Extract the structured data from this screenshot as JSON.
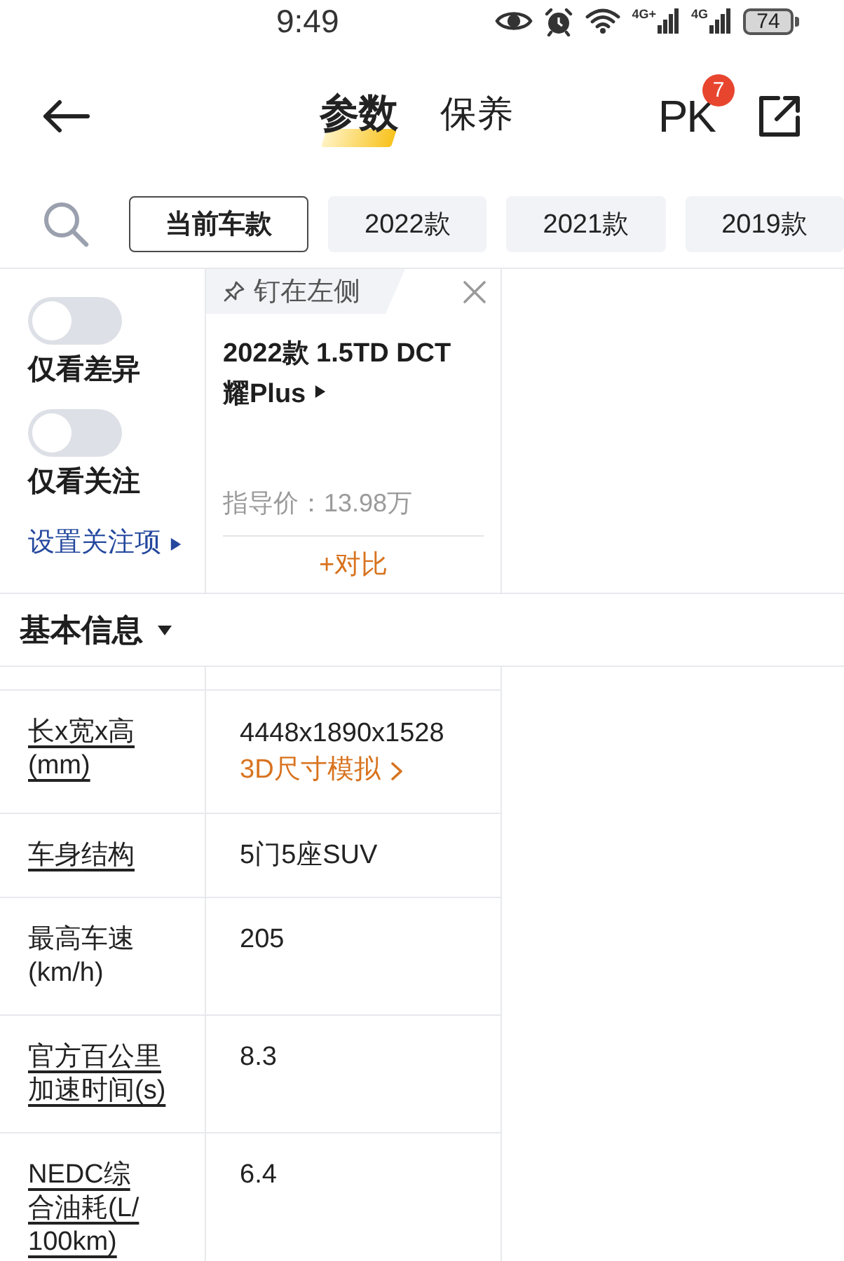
{
  "status_bar": {
    "time": "9:49",
    "networks": [
      {
        "label": "4G+"
      },
      {
        "label": "4G"
      }
    ],
    "battery": "74"
  },
  "header": {
    "tabs": [
      {
        "label": "参数",
        "selected": true
      },
      {
        "label": "保养",
        "selected": false
      }
    ],
    "pk_button": {
      "label": "PK",
      "badge": "7"
    }
  },
  "filter_bar": {
    "chips": [
      {
        "label": "当前车款",
        "selected": true
      },
      {
        "label": "2022款",
        "selected": false
      },
      {
        "label": "2021款",
        "selected": false
      },
      {
        "label": "2019款",
        "selected": false
      }
    ]
  },
  "left_panel": {
    "toggles": [
      {
        "label": "仅看差异",
        "on": false
      },
      {
        "label": "仅看关注",
        "on": false
      }
    ],
    "settings_link": "设置关注项"
  },
  "car_card": {
    "pin_label": "钉在左侧",
    "title": "2022款 1.5TD DCT 耀Plus",
    "price": "指导价：13.98万",
    "compare_button": "+对比"
  },
  "section": {
    "title": "基本信息",
    "expanded": true
  },
  "spec_rows": [
    {
      "label_lines": [
        "长x宽x高",
        "(mm)"
      ],
      "linked": true,
      "value": "4448x1890x1528",
      "value_link": "3D尺寸模拟"
    },
    {
      "label_lines": [
        "车身结构"
      ],
      "linked": true,
      "value": "5门5座SUV"
    },
    {
      "label_lines": [
        "最高车速",
        "(km/h)"
      ],
      "linked": false,
      "value": "205"
    },
    {
      "label_lines": [
        "官方百公里",
        "加速时间(s)"
      ],
      "linked": true,
      "value": "8.3"
    },
    {
      "label_lines": [
        "NEDC综",
        "合油耗(L/",
        "100km)"
      ],
      "linked": true,
      "value": "6.4"
    }
  ]
}
